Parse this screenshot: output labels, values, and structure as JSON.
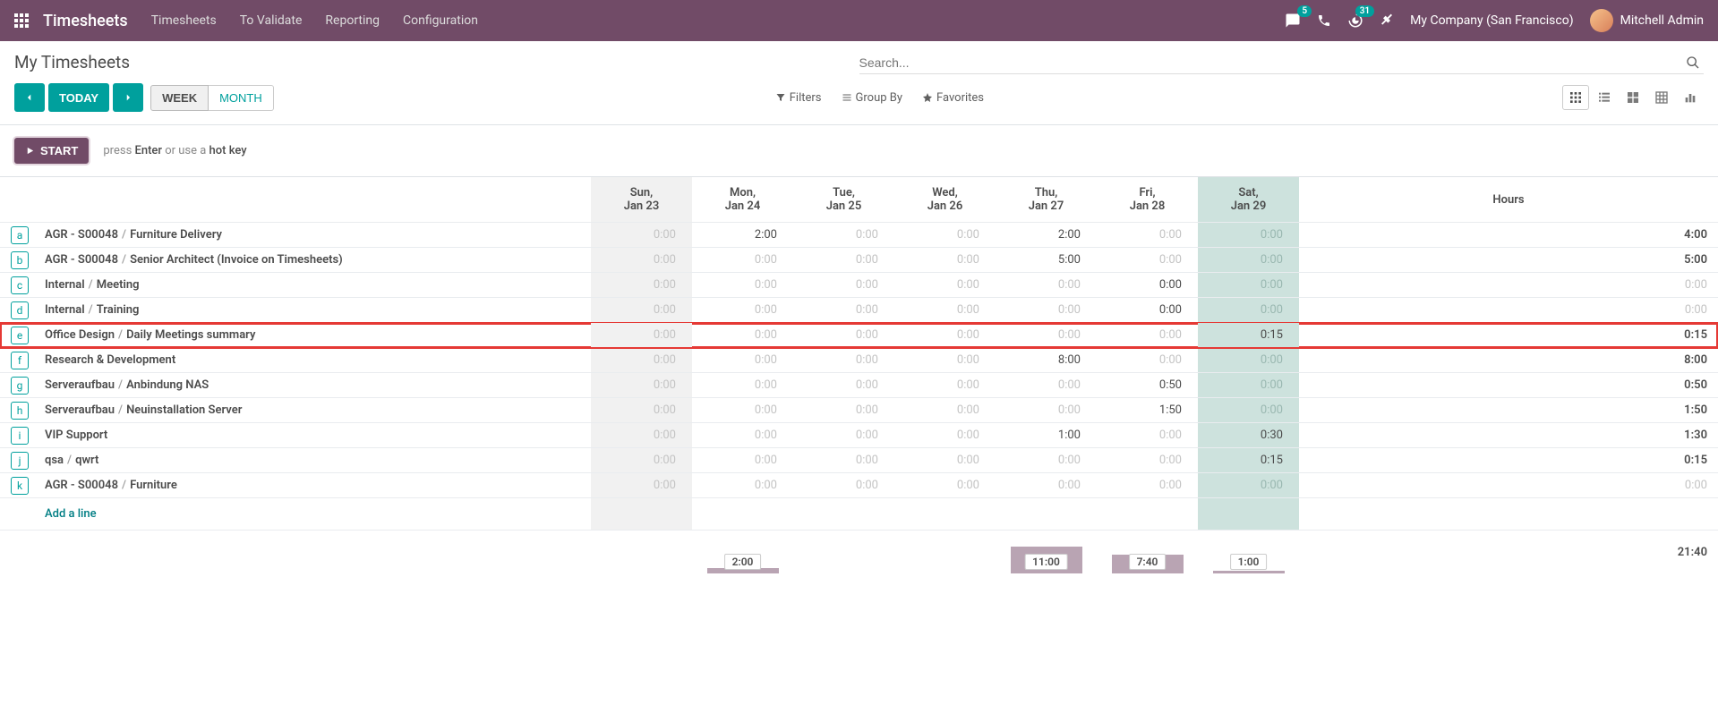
{
  "nav": {
    "brand": "Timesheets",
    "links": [
      "Timesheets",
      "To Validate",
      "Reporting",
      "Configuration"
    ],
    "messages_badge": "5",
    "activities_badge": "31",
    "company": "My Company (San Francisco)",
    "user": "Mitchell Admin"
  },
  "page": {
    "title": "My Timesheets",
    "search_placeholder": "Search...",
    "today": "TODAY",
    "week": "WEEK",
    "month": "MONTH",
    "filters": "Filters",
    "group_by": "Group By",
    "favorites": "Favorites"
  },
  "start": {
    "button": "START",
    "hint_pre": "press ",
    "hint_key": "Enter",
    "hint_mid": " or use a ",
    "hint_hot": "hot key"
  },
  "columns": {
    "days": [
      {
        "dow": "Sun,",
        "date": "Jan 23",
        "class": "sun"
      },
      {
        "dow": "Mon,",
        "date": "Jan 24",
        "class": ""
      },
      {
        "dow": "Tue,",
        "date": "Jan 25",
        "class": ""
      },
      {
        "dow": "Wed,",
        "date": "Jan 26",
        "class": ""
      },
      {
        "dow": "Thu,",
        "date": "Jan 27",
        "class": ""
      },
      {
        "dow": "Fri,",
        "date": "Jan 28",
        "class": ""
      },
      {
        "dow": "Sat,",
        "date": "Jan 29",
        "class": "sat"
      }
    ],
    "hours": "Hours"
  },
  "rows": [
    {
      "key": "a",
      "parts": [
        "AGR - S00048",
        "Furniture Delivery"
      ],
      "cells": [
        {
          "v": "0:00",
          "dim": true
        },
        {
          "v": "2:00",
          "dim": false
        },
        {
          "v": "0:00",
          "dim": true
        },
        {
          "v": "0:00",
          "dim": true
        },
        {
          "v": "2:00",
          "dim": false
        },
        {
          "v": "0:00",
          "dim": true
        },
        {
          "v": "0:00",
          "dim": true
        }
      ],
      "total": "4:00",
      "total_dim": false,
      "hl": false
    },
    {
      "key": "b",
      "parts": [
        "AGR - S00048",
        "Senior Architect (Invoice on Timesheets)"
      ],
      "cells": [
        {
          "v": "0:00",
          "dim": true
        },
        {
          "v": "0:00",
          "dim": true
        },
        {
          "v": "0:00",
          "dim": true
        },
        {
          "v": "0:00",
          "dim": true
        },
        {
          "v": "5:00",
          "dim": false
        },
        {
          "v": "0:00",
          "dim": true
        },
        {
          "v": "0:00",
          "dim": true
        }
      ],
      "total": "5:00",
      "total_dim": false,
      "hl": false
    },
    {
      "key": "c",
      "parts": [
        "Internal",
        "Meeting"
      ],
      "cells": [
        {
          "v": "0:00",
          "dim": true
        },
        {
          "v": "0:00",
          "dim": true
        },
        {
          "v": "0:00",
          "dim": true
        },
        {
          "v": "0:00",
          "dim": true
        },
        {
          "v": "0:00",
          "dim": true
        },
        {
          "v": "0:00",
          "dim": false
        },
        {
          "v": "0:00",
          "dim": true
        }
      ],
      "total": "0:00",
      "total_dim": true,
      "hl": false
    },
    {
      "key": "d",
      "parts": [
        "Internal",
        "Training"
      ],
      "cells": [
        {
          "v": "0:00",
          "dim": true
        },
        {
          "v": "0:00",
          "dim": true
        },
        {
          "v": "0:00",
          "dim": true
        },
        {
          "v": "0:00",
          "dim": true
        },
        {
          "v": "0:00",
          "dim": true
        },
        {
          "v": "0:00",
          "dim": false
        },
        {
          "v": "0:00",
          "dim": true
        }
      ],
      "total": "0:00",
      "total_dim": true,
      "hl": false
    },
    {
      "key": "e",
      "parts": [
        "Office Design",
        "Daily Meetings summary"
      ],
      "cells": [
        {
          "v": "0:00",
          "dim": true
        },
        {
          "v": "0:00",
          "dim": true
        },
        {
          "v": "0:00",
          "dim": true
        },
        {
          "v": "0:00",
          "dim": true
        },
        {
          "v": "0:00",
          "dim": true
        },
        {
          "v": "0:00",
          "dim": true
        },
        {
          "v": "0:15",
          "dim": false
        }
      ],
      "total": "0:15",
      "total_dim": false,
      "hl": true
    },
    {
      "key": "f",
      "parts": [
        "Research & Development"
      ],
      "cells": [
        {
          "v": "0:00",
          "dim": true
        },
        {
          "v": "0:00",
          "dim": true
        },
        {
          "v": "0:00",
          "dim": true
        },
        {
          "v": "0:00",
          "dim": true
        },
        {
          "v": "8:00",
          "dim": false
        },
        {
          "v": "0:00",
          "dim": true
        },
        {
          "v": "0:00",
          "dim": true
        }
      ],
      "total": "8:00",
      "total_dim": false,
      "hl": false
    },
    {
      "key": "g",
      "parts": [
        "Serveraufbau",
        "Anbindung NAS"
      ],
      "cells": [
        {
          "v": "0:00",
          "dim": true
        },
        {
          "v": "0:00",
          "dim": true
        },
        {
          "v": "0:00",
          "dim": true
        },
        {
          "v": "0:00",
          "dim": true
        },
        {
          "v": "0:00",
          "dim": true
        },
        {
          "v": "0:50",
          "dim": false
        },
        {
          "v": "0:00",
          "dim": true
        }
      ],
      "total": "0:50",
      "total_dim": false,
      "hl": false
    },
    {
      "key": "h",
      "parts": [
        "Serveraufbau",
        "Neuinstallation Server"
      ],
      "cells": [
        {
          "v": "0:00",
          "dim": true
        },
        {
          "v": "0:00",
          "dim": true
        },
        {
          "v": "0:00",
          "dim": true
        },
        {
          "v": "0:00",
          "dim": true
        },
        {
          "v": "0:00",
          "dim": true
        },
        {
          "v": "1:50",
          "dim": false
        },
        {
          "v": "0:00",
          "dim": true
        }
      ],
      "total": "1:50",
      "total_dim": false,
      "hl": false
    },
    {
      "key": "i",
      "parts": [
        "VIP Support"
      ],
      "cells": [
        {
          "v": "0:00",
          "dim": true
        },
        {
          "v": "0:00",
          "dim": true
        },
        {
          "v": "0:00",
          "dim": true
        },
        {
          "v": "0:00",
          "dim": true
        },
        {
          "v": "1:00",
          "dim": false
        },
        {
          "v": "0:00",
          "dim": true
        },
        {
          "v": "0:30",
          "dim": false
        }
      ],
      "total": "1:30",
      "total_dim": false,
      "hl": false
    },
    {
      "key": "j",
      "parts": [
        "qsa",
        "qwrt"
      ],
      "cells": [
        {
          "v": "0:00",
          "dim": true
        },
        {
          "v": "0:00",
          "dim": true
        },
        {
          "v": "0:00",
          "dim": true
        },
        {
          "v": "0:00",
          "dim": true
        },
        {
          "v": "0:00",
          "dim": true
        },
        {
          "v": "0:00",
          "dim": true
        },
        {
          "v": "0:15",
          "dim": false
        }
      ],
      "total": "0:15",
      "total_dim": false,
      "hl": false
    },
    {
      "key": "k",
      "parts": [
        "AGR - S00048",
        "Furniture"
      ],
      "cells": [
        {
          "v": "0:00",
          "dim": true
        },
        {
          "v": "0:00",
          "dim": true
        },
        {
          "v": "0:00",
          "dim": true
        },
        {
          "v": "0:00",
          "dim": true
        },
        {
          "v": "0:00",
          "dim": true
        },
        {
          "v": "0:00",
          "dim": true
        },
        {
          "v": "0:00",
          "dim": true
        }
      ],
      "total": "0:00",
      "total_dim": true,
      "hl": false
    }
  ],
  "add_line": "Add a line",
  "footer": {
    "max_minutes": 960,
    "cells": [
      {
        "label": "",
        "minutes": 0
      },
      {
        "label": "2:00",
        "minutes": 120
      },
      {
        "label": "",
        "minutes": 0
      },
      {
        "label": "",
        "minutes": 0
      },
      {
        "label": "11:00",
        "minutes": 660
      },
      {
        "label": "7:40",
        "minutes": 460
      },
      {
        "label": "1:00",
        "minutes": 60
      }
    ],
    "grand_total": "21:40"
  }
}
